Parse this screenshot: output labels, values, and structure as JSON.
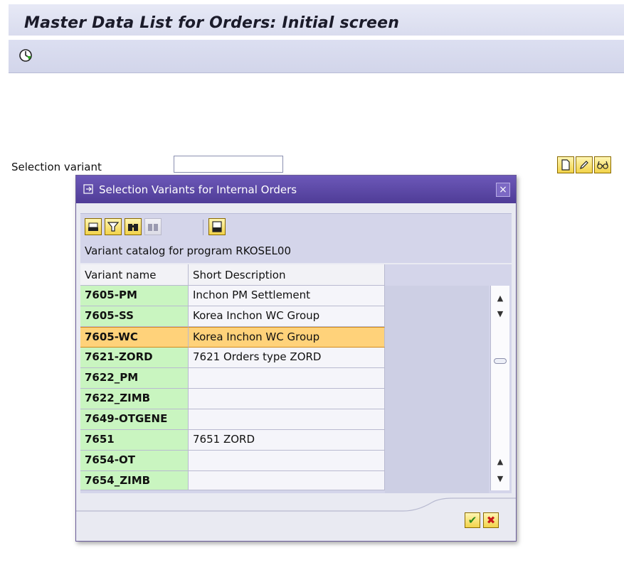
{
  "window": {
    "title": "Master Data List for Orders: Initial screen"
  },
  "toolbar": {
    "execute_icon": "clock-execute-icon"
  },
  "selection": {
    "label": "Selection variant",
    "value": ""
  },
  "tool_icons": [
    "new-document-icon",
    "pencil-edit-icon",
    "glasses-display-icon"
  ],
  "dialog": {
    "title": "Selection Variants for Internal Orders",
    "close_symbol": "×",
    "catalog_text": "Variant catalog for program RKOSEL00",
    "toolbar_icons": [
      "printer-icon",
      "filter-icon",
      "find-icon",
      "find-next-icon",
      "print-list-icon"
    ],
    "columns": {
      "name": "Variant name",
      "description": "Short Description"
    },
    "rows": [
      {
        "name": "7605-PM",
        "description": "Inchon PM Settlement"
      },
      {
        "name": "7605-SS",
        "description": "Korea Inchon WC Group"
      },
      {
        "name": "7605-WC",
        "description": "Korea Inchon WC Group"
      },
      {
        "name": "7621-ZORD",
        "description": "7621 Orders type ZORD"
      },
      {
        "name": "7622_PM",
        "description": ""
      },
      {
        "name": "7622_ZIMB",
        "description": ""
      },
      {
        "name": "7649-OTGENE",
        "description": ""
      },
      {
        "name": "7651",
        "description": "7651 ZORD"
      },
      {
        "name": "7654-OT",
        "description": ""
      },
      {
        "name": "7654_ZIMB",
        "description": ""
      }
    ],
    "selected_index": 2,
    "ok_symbol": "✔",
    "cancel_symbol": "✖"
  },
  "colors": {
    "title_bar": "#6c58b8",
    "variant_cell": "#c9f5c0",
    "selected_row": "#ffd27a"
  }
}
